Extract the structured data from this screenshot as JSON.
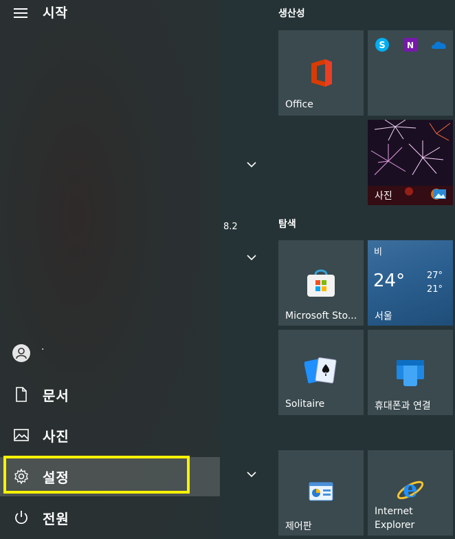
{
  "start_menu": {
    "title": "시작"
  },
  "user": {
    "name": "·"
  },
  "nav": {
    "documents": "문서",
    "pictures": "사진",
    "settings": "설정",
    "power": "전원"
  },
  "middle": {
    "version_text": "8.2"
  },
  "groups": {
    "productivity": "생산성",
    "explore": "탐색"
  },
  "tiles": {
    "office": "Office",
    "photos": "사진",
    "store": "Microsoft Sto...",
    "solitaire": "Solitaire",
    "phone_link": "휴대폰과 연결",
    "control_panel": "제어판",
    "ie_line1": "Internet",
    "ie_line2": "Explorer",
    "mini_icons": [
      "skype-icon",
      "onenote-icon",
      "onedrive-icon"
    ]
  },
  "weather": {
    "condition": "비",
    "temp": "24°",
    "high": "27°",
    "low": "21°",
    "city": "서울"
  },
  "colors": {
    "highlight": "#fff200",
    "tile_bg": "#3a4a4f",
    "weather_bg": "#2b5f8f"
  }
}
